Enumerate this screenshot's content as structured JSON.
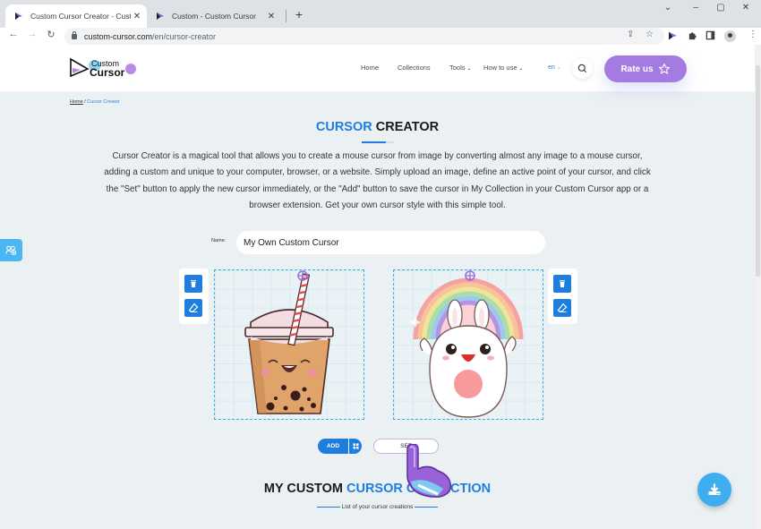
{
  "browser": {
    "tabs": [
      {
        "title": "Custom Cursor Creator - Custom",
        "active": true
      },
      {
        "title": "Custom - Custom Cursor",
        "active": false
      }
    ],
    "url_host": "custom-cursor.com",
    "url_path": "/en/cursor-creator",
    "window_controls": {
      "dropdown": "⌄",
      "minimize": "–",
      "maximize": "▢",
      "close": "✕"
    }
  },
  "site": {
    "logo": {
      "line1": "Custom",
      "line2": "Cursor"
    },
    "nav": [
      {
        "label": "Home",
        "has_dropdown": false
      },
      {
        "label": "Collections",
        "has_dropdown": false
      },
      {
        "label": "Tools",
        "has_dropdown": true
      },
      {
        "label": "How to use",
        "has_dropdown": true
      }
    ],
    "language": "en",
    "rate_button": "Rate us",
    "colors": {
      "accent": "#1e7ee0",
      "rate_button": "#a47be0",
      "page_bg": "#ebf0f3",
      "fab": "#3eaef0"
    }
  },
  "breadcrumb": {
    "home": "Home",
    "separator": "/",
    "current": "Cursor Creator"
  },
  "page": {
    "title_accent": "CURSOR",
    "title_rest": "CREATOR",
    "intro": "Cursor Creator is a magical tool that allows you to create a mouse cursor from image by converting almost any image to a mouse cursor, adding a custom and unique to your computer, browser, or a website. Simply upload an image, define an active point of your cursor, and click the \"Set\" button to apply the new cursor immediately, or the \"Add\" button to save the cursor in My Collection in your Custom Cursor app or a browser extension. Get your own cursor style with this simple tool."
  },
  "creator": {
    "name_label": "Name:",
    "name_value": "My Own Custom Cursor",
    "left_canvas": {
      "image": "bubble-tea-cup",
      "tools": [
        "delete-icon",
        "eraser-icon"
      ]
    },
    "right_canvas": {
      "image": "bunny-rainbow",
      "tools": [
        "delete-icon",
        "eraser-icon"
      ]
    },
    "add_button": "ADD",
    "set_button": "SET"
  },
  "collection": {
    "title_start": "MY CUSTOM",
    "title_accent": "CURSOR COLLECTION",
    "subtitle": "List of your cursor creations"
  }
}
